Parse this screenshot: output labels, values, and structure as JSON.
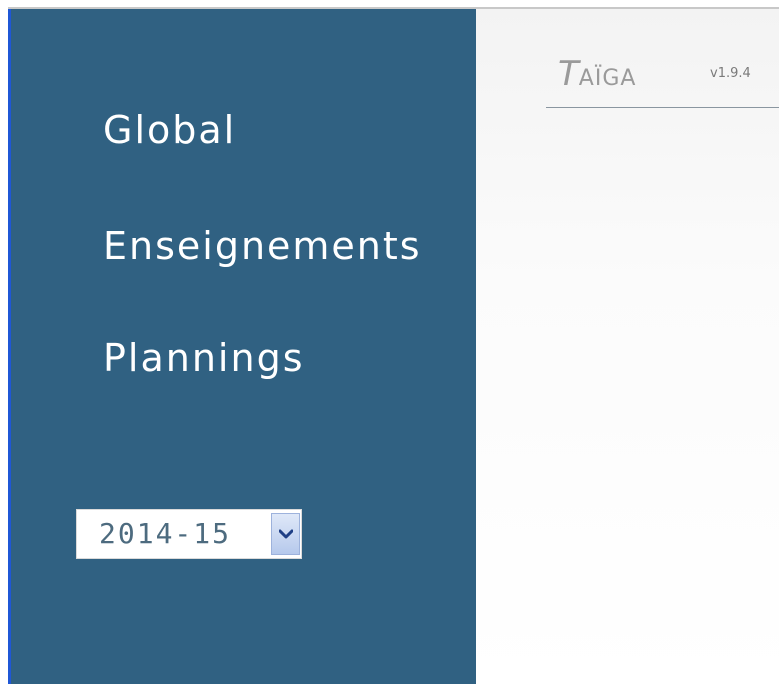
{
  "app": {
    "brand": {
      "first_letter": "T",
      "rest": "AÏGA"
    },
    "version": "v1.9.4"
  },
  "sidebar": {
    "items": [
      {
        "label": "Global"
      },
      {
        "label": "Enseignements"
      },
      {
        "label": "Plannings"
      }
    ],
    "year_select": {
      "value": "2014-15"
    }
  },
  "colors": {
    "sidebar_bg": "#306182",
    "left_accent": "#1f57d6",
    "nav_text": "#ffffff",
    "brand_text": "#9a9a9a"
  },
  "icons": {
    "year_dropdown": "chevron-down-icon"
  }
}
